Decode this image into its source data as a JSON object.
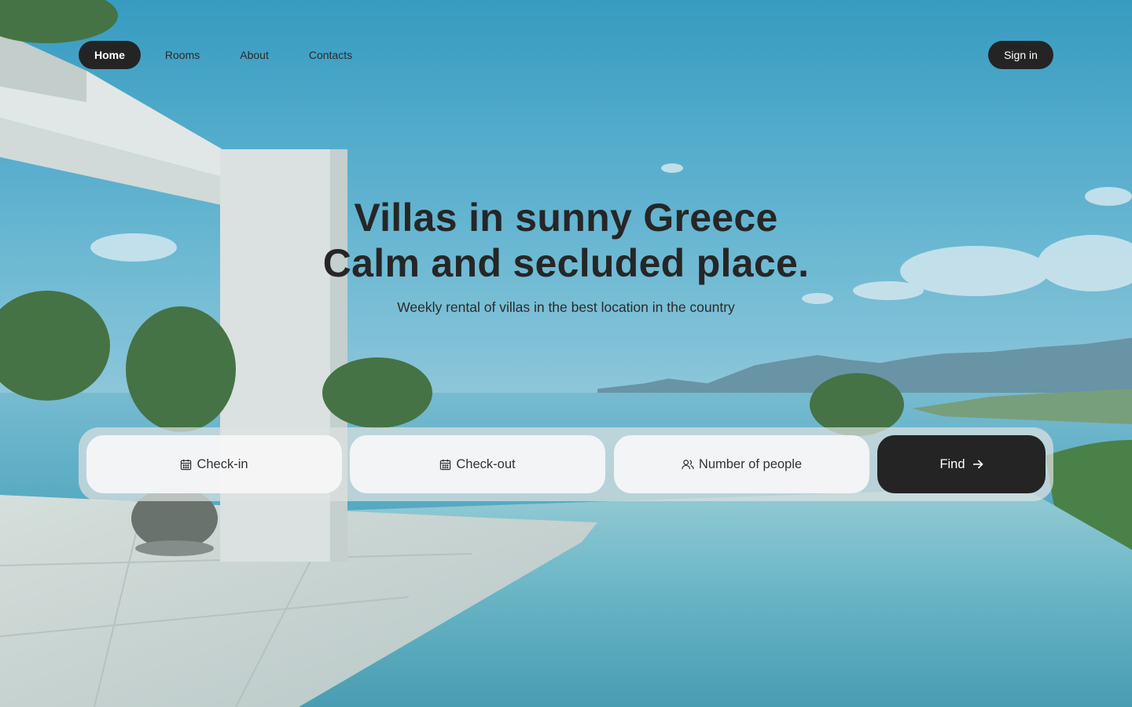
{
  "nav": {
    "items": [
      {
        "label": "Home",
        "active": true
      },
      {
        "label": "Rooms",
        "active": false
      },
      {
        "label": "About",
        "active": false
      },
      {
        "label": "Contacts",
        "active": false
      }
    ],
    "signin_label": "Sign in"
  },
  "hero": {
    "title_line1": "Villas in sunny Greece",
    "title_line2": "Calm and secluded place.",
    "subtitle": "Weekly rental of villas in the best location in the country"
  },
  "search": {
    "checkin": {
      "label": "Check-in",
      "icon": "calendar-icon"
    },
    "checkout": {
      "label": "Check-out",
      "icon": "calendar-icon"
    },
    "people": {
      "label": "Number of people",
      "icon": "users-icon"
    },
    "find": {
      "label": "Find",
      "icon": "arrow-right-icon"
    }
  },
  "colors": {
    "dark": "#242424",
    "sky": "#2e9ec1",
    "sea": "#3f9db8",
    "deck": "#c4d2d0"
  }
}
